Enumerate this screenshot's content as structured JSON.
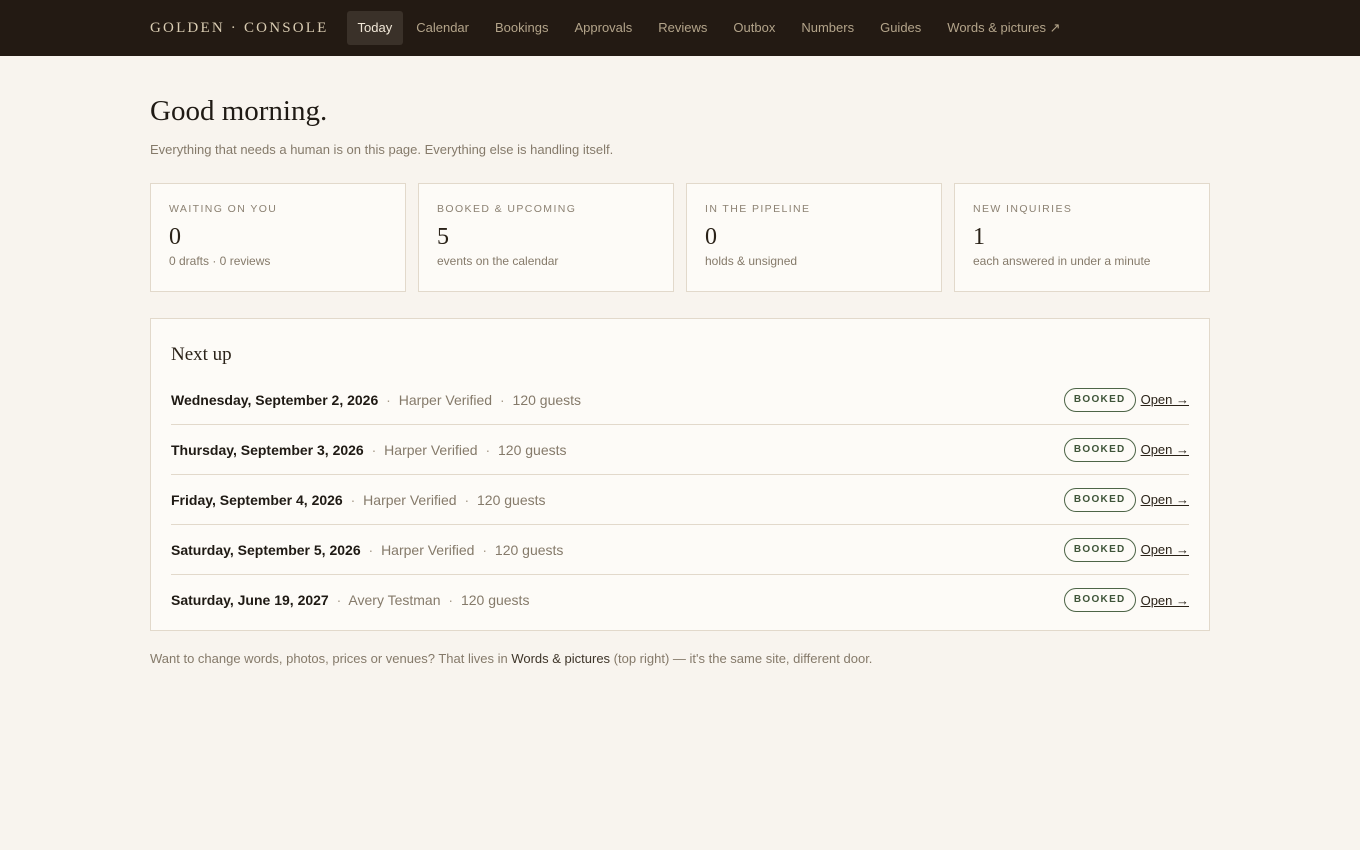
{
  "header": {
    "brand": "GOLDEN · CONSOLE",
    "nav": [
      {
        "label": "Today",
        "active": true
      },
      {
        "label": "Calendar"
      },
      {
        "label": "Bookings"
      },
      {
        "label": "Approvals"
      },
      {
        "label": "Reviews"
      },
      {
        "label": "Outbox"
      },
      {
        "label": "Numbers"
      },
      {
        "label": "Guides"
      },
      {
        "label": "Words & pictures ↗"
      }
    ]
  },
  "main": {
    "greeting": "Good morning.",
    "subtitle": "Everything that needs a human is on this page. Everything else is handling itself.",
    "stats": [
      {
        "label": "Waiting on you",
        "value": "0",
        "sub": "0 drafts · 0 reviews"
      },
      {
        "label": "Booked & upcoming",
        "value": "5",
        "sub": "events on the calendar"
      },
      {
        "label": "In the pipeline",
        "value": "0",
        "sub": "holds & unsigned"
      },
      {
        "label": "New inquiries",
        "value": "1",
        "sub": "each answered in under a minute"
      }
    ],
    "next_up": {
      "title": "Next up",
      "events": [
        {
          "date": "Wednesday, September 2, 2026",
          "client": "Harper Verified",
          "guests": "120 guests",
          "status": "BOOKED",
          "action": "Open →"
        },
        {
          "date": "Thursday, September 3, 2026",
          "client": "Harper Verified",
          "guests": "120 guests",
          "status": "BOOKED",
          "action": "Open →"
        },
        {
          "date": "Friday, September 4, 2026",
          "client": "Harper Verified",
          "guests": "120 guests",
          "status": "BOOKED",
          "action": "Open →"
        },
        {
          "date": "Saturday, September 5, 2026",
          "client": "Harper Verified",
          "guests": "120 guests",
          "status": "BOOKED",
          "action": "Open →"
        },
        {
          "date": "Saturday, June 19, 2027",
          "client": "Avery Testman",
          "guests": "120 guests",
          "status": "BOOKED",
          "action": "Open →"
        }
      ]
    },
    "footnote": {
      "before": "Want to change words, photos, prices or venues? That lives in ",
      "link": "Words & pictures",
      "after": " (top right) — it's the same site, different door."
    }
  },
  "colors": {
    "topbar": "#231a13",
    "background": "#f8f4ee",
    "badge_green": "#3e5438"
  }
}
